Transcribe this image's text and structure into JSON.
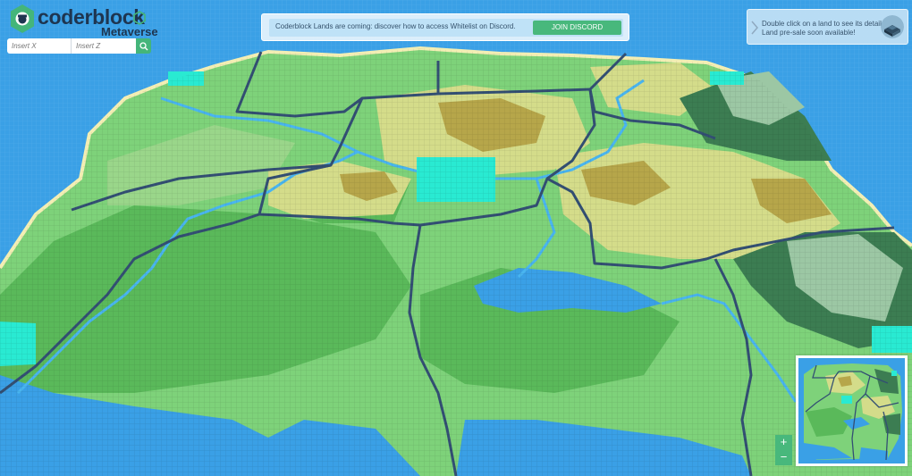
{
  "brand": {
    "name": "coderblock",
    "sub": "Metaverse"
  },
  "search": {
    "x_placeholder": "Insert X",
    "z_placeholder": "Insert Z"
  },
  "banner": {
    "text": "Coderblock Lands are coming: discover how to access Whitelist on Discord.",
    "button_label": "JOIN DISCORD"
  },
  "info": {
    "line1": "Double click on a land to see its details.",
    "line2": "Land pre-sale soon available!"
  },
  "minimap": {
    "zoom_in_label": "+",
    "zoom_out_label": "−"
  },
  "colors": {
    "ocean": "#3aa0e6",
    "grass_light": "#7ed27a",
    "grass_mid": "#5ab95a",
    "grass_dark": "#3f9147",
    "sand_light": "#d4dc8a",
    "sand_dark": "#b6a64a",
    "forest": "#3c7d52",
    "forest_light": "#9cc7a4",
    "highlight": "#29ead2",
    "border_line": "#334f73",
    "accent_green": "#48b87c"
  }
}
